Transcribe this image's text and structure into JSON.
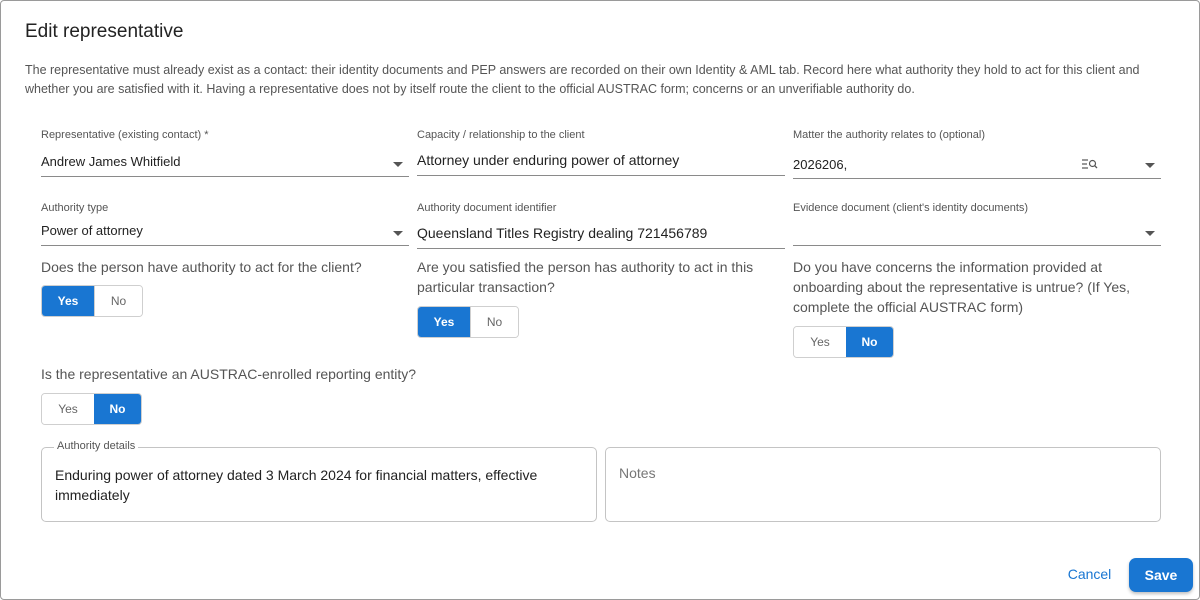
{
  "dialog": {
    "title": "Edit representative",
    "intro": "The representative must already exist as a contact: their identity documents and PEP answers are recorded on their own Identity & AML tab. Record here what authority they hold to act for this client and whether you are satisfied with it. Having a representative does not by itself route the client to the official AUSTRAC form; concerns or an unverifiable authority do."
  },
  "fields": {
    "representative": {
      "label": "Representative (existing contact) *",
      "value": "Andrew James Whitfield"
    },
    "capacity": {
      "label": "Capacity / relationship to the client",
      "value": "Attorney under enduring power of attorney"
    },
    "matter": {
      "label": "Matter the authority relates to (optional)",
      "value": "2026206,"
    },
    "authority_type": {
      "label": "Authority type",
      "value": "Power of attorney"
    },
    "authority_doc_id": {
      "label": "Authority document identifier",
      "value": "Queensland Titles Registry dealing 721456789"
    },
    "evidence_doc": {
      "label": "Evidence document (client's identity documents)",
      "value": ""
    }
  },
  "questions": {
    "has_authority": {
      "text": "Does the person have authority to act for the client?",
      "yes": "Yes",
      "no": "No",
      "selected": "Yes"
    },
    "satisfied": {
      "text": "Are you satisfied the person has authority to act in this particular transaction?",
      "yes": "Yes",
      "no": "No",
      "selected": "Yes"
    },
    "concerns": {
      "text": "Do you have concerns the information provided at onboarding about the representative is untrue? (If Yes, complete the official AUSTRAC form)",
      "yes": "Yes",
      "no": "No",
      "selected": "No"
    },
    "austrac_enrolled": {
      "text": "Is the representative an AUSTRAC-enrolled reporting entity?",
      "yes": "Yes",
      "no": "No",
      "selected": "No"
    }
  },
  "authority_details": {
    "legend": "Authority details",
    "value": "Enduring power of attorney dated 3 March 2024 for financial matters, effective immediately"
  },
  "notes": {
    "placeholder": "Notes"
  },
  "actions": {
    "cancel": "Cancel",
    "save": "Save"
  },
  "icons": {
    "dropdown": "chevron-down-icon",
    "lookup": "search-list-icon"
  },
  "colors": {
    "accent": "#1976d2"
  }
}
